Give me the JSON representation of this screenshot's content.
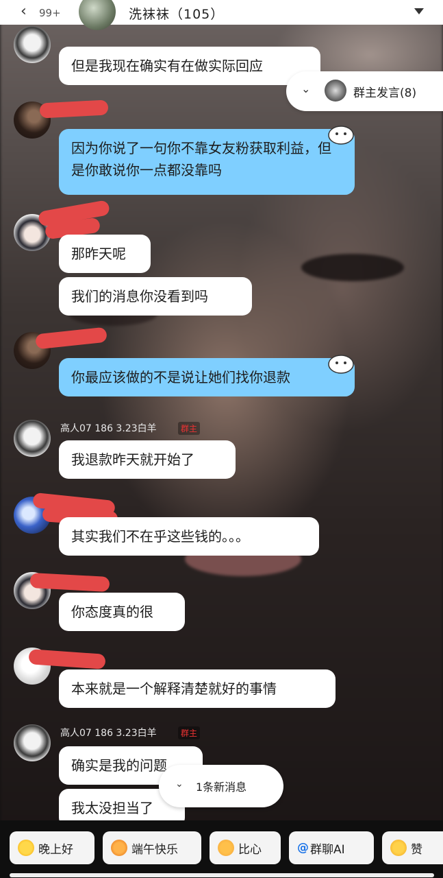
{
  "header": {
    "unread_count": "99+",
    "group_name": "洗袜袜（105）"
  },
  "floating": {
    "owner_speak": "群主发言(8)",
    "new_messages": "1条新消息"
  },
  "messages": [
    {
      "text": "但是我现在确实有在做实际回应"
    },
    {
      "text": "因为你说了一句你不靠女友粉获取利益，但是你敢说你一点都没靠吗"
    },
    {
      "text": "那昨天呢"
    },
    {
      "text": "我们的消息你没看到吗"
    },
    {
      "text": "你最应该做的不是说让她们找你退款"
    },
    {
      "sender": "高人07 186 3.23白羊",
      "tag": "群主",
      "text": "我退款昨天就开始了"
    },
    {
      "text": "其实我们不在乎这些钱的。。。"
    },
    {
      "text": "你态度真的很"
    },
    {
      "text": "本来就是一个解释清楚就好的事情"
    },
    {
      "sender": "高人07 186 3.23白羊",
      "tag": "群主",
      "text": "确实是我的问题"
    },
    {
      "text": "我太没担当了"
    }
  ],
  "quick_replies": [
    {
      "label": "晚上好",
      "icon": "sun-emoji-icon"
    },
    {
      "label": "端午快乐",
      "icon": "tiger-emoji-icon"
    },
    {
      "label": "比心",
      "icon": "finger-heart-icon"
    },
    {
      "label": "群聊AI",
      "icon": "at-icon"
    },
    {
      "label": "赞",
      "icon": "thumbs-up-icon"
    }
  ],
  "colors": {
    "blue_bubble": "#7fcfff",
    "owner_tag": "#e33333",
    "redaction": "#e34848"
  }
}
